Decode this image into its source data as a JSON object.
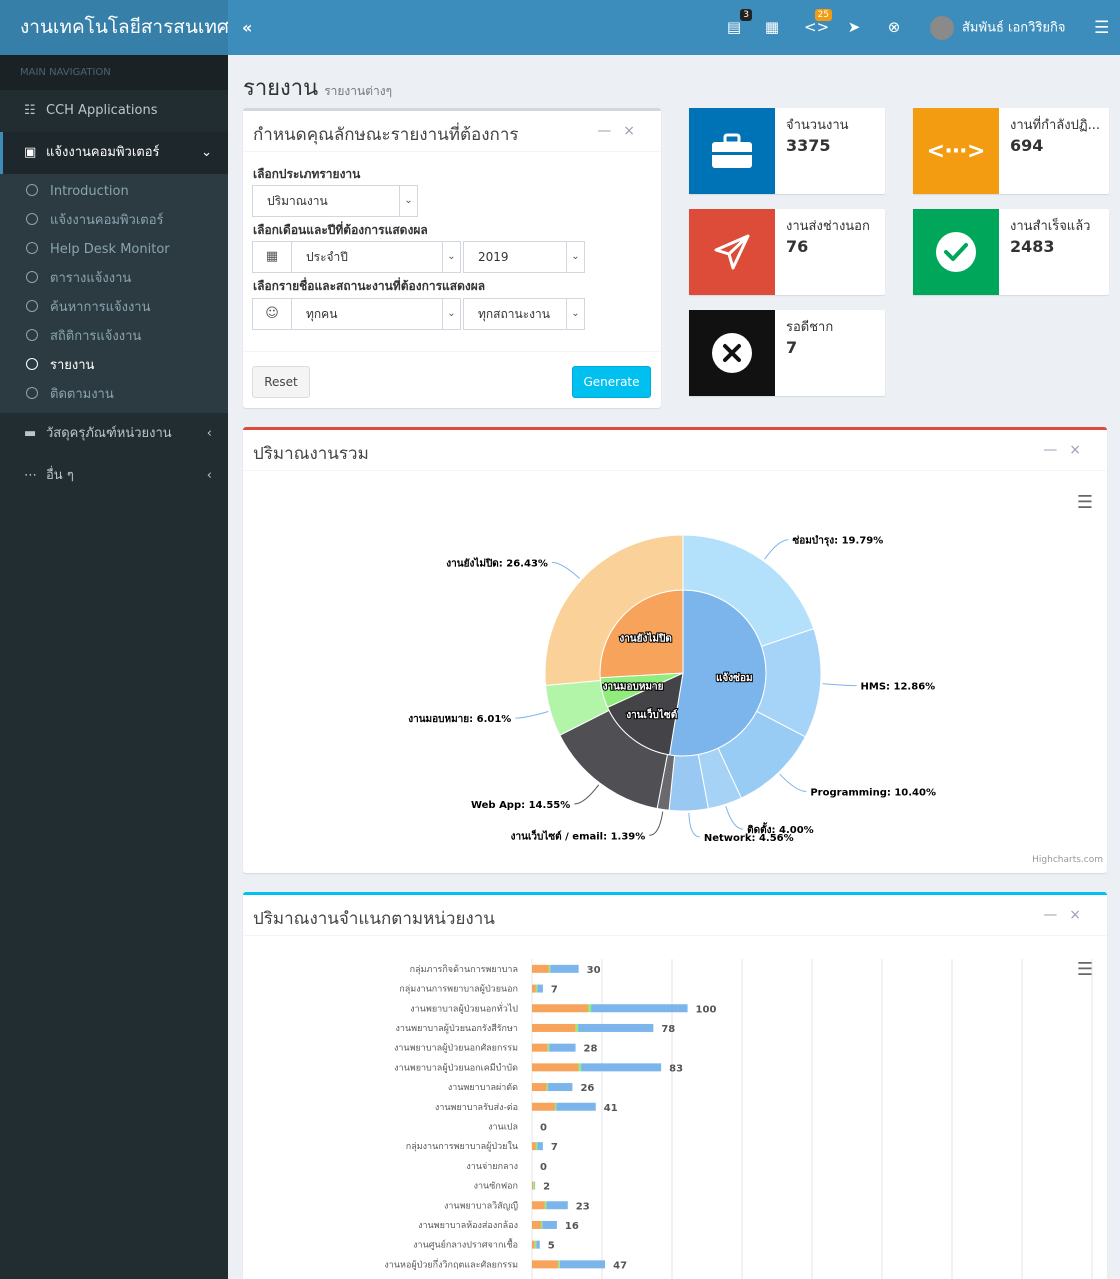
{
  "header": {
    "logo": "งานเทคโนโลยีสารสนเทศ",
    "toggle": "«",
    "notif1_count": "3",
    "notif2_count": "25",
    "user_name": "สัมพันธ์ เอกวิริยกิจ"
  },
  "sidebar": {
    "heading": "MAIN NAVIGATION",
    "items": [
      {
        "label": "CCH Applications",
        "icon": "robot-icon"
      },
      {
        "label": "แจ้งงานคอมพิวเตอร์",
        "icon": "computer-icon"
      }
    ],
    "sub": [
      {
        "label": "Introduction"
      },
      {
        "label": "แจ้งงานคอมพิวเตอร์"
      },
      {
        "label": "Help Desk Monitor"
      },
      {
        "label": "ตารางแจ้งงาน"
      },
      {
        "label": "ค้นหาการแจ้งงาน"
      },
      {
        "label": "สถิติการแจ้งงาน"
      },
      {
        "label": "รายงาน"
      },
      {
        "label": "ติดตามงาน"
      }
    ],
    "bottom": [
      {
        "label": "วัสดุครุภัณฑ์หน่วยงาน"
      },
      {
        "label": "อื่น ๆ"
      }
    ]
  },
  "page": {
    "title": "รายงาน",
    "subtitle": "รายงานต่างๆ"
  },
  "form": {
    "title": "กำหนดคุณลักษณะรายงานที่ต้องการ",
    "label_type": "เลือกประเภทรายงาน",
    "type_value": "ปริมาณงาน",
    "label_period": "เลือกเดือนและปีที่ต้องการแสดงผล",
    "month_value": "ประจำปี",
    "year_value": "2019",
    "label_person": "เลือกรายชื่อและสถานะงานที่ต้องการแสดงผล",
    "person_value": "ทุกคน",
    "status_value": "ทุกสถานะงาน",
    "reset": "Reset",
    "generate": "Generate"
  },
  "stats": [
    {
      "label": "จำนวนงาน",
      "value": "3375",
      "color": "#0073b7",
      "icon": "briefcase-icon"
    },
    {
      "label": "งานที่กำลังปฏิ...",
      "value": "694",
      "color": "#f39c12",
      "icon": "code-icon"
    },
    {
      "label": "งานส่งช่างนอก",
      "value": "76",
      "color": "#dd4b39",
      "icon": "paper-plane-icon"
    },
    {
      "label": "งานสำเร็จแล้ว",
      "value": "2483",
      "color": "#00a65a",
      "icon": "check-icon"
    },
    {
      "label": "รอดีชาก",
      "value": "7",
      "color": "#111111",
      "icon": "times-icon"
    }
  ],
  "pie_box": {
    "title": "ปริมาณงานรวม",
    "credit": "Highcharts.com"
  },
  "bar_box": {
    "title": "ปริมาณงานจำแนกตามหน่วยงาน"
  },
  "chart_data": [
    {
      "type": "pie",
      "inner": [
        {
          "name": "แจ้งซ่อม",
          "value": 53.6,
          "color": "#7cb5ec"
        },
        {
          "name": "งานเว็บไซต์",
          "value": 15.9,
          "color": "#434348"
        },
        {
          "name": "งานมอบหมาย",
          "value": 6.0,
          "color": "#90ed7d"
        },
        {
          "name": "งานยังไม่ปิด",
          "value": 26.4,
          "color": "#f7a35c"
        }
      ],
      "outer": [
        {
          "label": "ซ่อมบำรุง: 19.79%",
          "value": 19.79,
          "color": "#b3e1fb"
        },
        {
          "label": "HMS: 12.86%",
          "value": 12.86,
          "color": "#a6d4f8"
        },
        {
          "label": "Programming: 10.40%",
          "value": 10.4,
          "color": "#99ccf5"
        },
        {
          "label": "ติดตั้ง: 4.00%",
          "value": 4.0,
          "color": "#a6d2f6"
        },
        {
          "label": "Network: 4.56%",
          "value": 4.56,
          "color": "#99c8f2"
        },
        {
          "label": "งานเว็บไซต์ / email: 1.39%",
          "value": 1.39,
          "color": "#6a6a6e"
        },
        {
          "label": "Web App: 14.55%",
          "value": 14.55,
          "color": "#4f4f54"
        },
        {
          "label": "งานมอบหมาย: 6.01%",
          "value": 6.01,
          "color": "#b3f5a8"
        },
        {
          "label": "งานยังไม่ปิด: 26.43%",
          "value": 26.43,
          "color": "#fad199"
        }
      ]
    },
    {
      "type": "bar",
      "categories": [
        "กลุ่มภารกิจด้านการพยาบาล",
        "กลุ่มงานการพยาบาลผู้ป่วยนอก",
        "งานพยาบาลผู้ป่วยนอกทั่วไป",
        "งานพยาบาลผู้ป่วยนอกรังสีรักษา",
        "งานพยาบาลผู้ป่วยนอกศัลยกรรม",
        "งานพยาบาลผู้ป่วยนอกเคมีบำบัด",
        "งานพยาบาลผ่าตัด",
        "งานพยาบาลรับส่ง-ต่อ",
        "งานเปล",
        "กลุ่มงานการพยาบาลผู้ป่วยใน",
        "งานจ่ายกลาง",
        "งานซักฟอก",
        "งานพยาบาลวิสัญญี",
        "งานพยาบาลห้องส่องกล้อง",
        "งานศูนย์กลางปราศจากเชื้อ",
        "งานหอผู้ป่วยกึ่งวิกฤตและศัลยกรรม"
      ],
      "values": [
        30,
        7,
        100,
        78,
        28,
        83,
        26,
        41,
        0,
        7,
        0,
        2,
        23,
        16,
        5,
        47
      ]
    }
  ]
}
